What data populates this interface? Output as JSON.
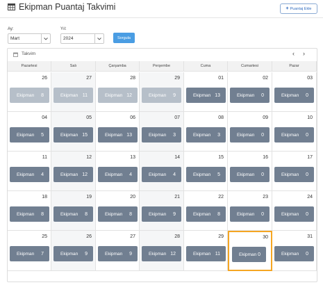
{
  "header": {
    "title": "Ekipman Puantaj Takvimi",
    "add_button": "Puantaj Ekle"
  },
  "filters": {
    "month_label": "Ay:",
    "month_value": "Mart",
    "year_label": "Yıl:",
    "year_value": "2024",
    "query_button": "Sorgula"
  },
  "calendar": {
    "title": "Takvim",
    "prev": "‹",
    "next": "›",
    "days": [
      "Pazartesi",
      "Salı",
      "Çarşamba",
      "Perşembe",
      "Cuma",
      "Cumartesi",
      "Pazar"
    ],
    "badge_label": "Ekipman",
    "weeks": [
      [
        {
          "day": "26",
          "count": "8",
          "faded": true
        },
        {
          "day": "27",
          "count": "11",
          "faded": true
        },
        {
          "day": "28",
          "count": "12",
          "faded": true
        },
        {
          "day": "29",
          "count": "9",
          "faded": true
        },
        {
          "day": "01",
          "count": "13"
        },
        {
          "day": "02",
          "count": "0"
        },
        {
          "day": "03",
          "count": "0"
        }
      ],
      [
        {
          "day": "04",
          "count": "5"
        },
        {
          "day": "05",
          "count": "15"
        },
        {
          "day": "06",
          "count": "13"
        },
        {
          "day": "07",
          "count": "3"
        },
        {
          "day": "08",
          "count": "3"
        },
        {
          "day": "09",
          "count": "0"
        },
        {
          "day": "10",
          "count": "0"
        }
      ],
      [
        {
          "day": "11",
          "count": "4"
        },
        {
          "day": "12",
          "count": "12"
        },
        {
          "day": "13",
          "count": "4"
        },
        {
          "day": "14",
          "count": "4"
        },
        {
          "day": "15",
          "count": "5"
        },
        {
          "day": "16",
          "count": "0"
        },
        {
          "day": "17",
          "count": "0"
        }
      ],
      [
        {
          "day": "18",
          "count": "8"
        },
        {
          "day": "19",
          "count": "8"
        },
        {
          "day": "20",
          "count": "8"
        },
        {
          "day": "21",
          "count": "9"
        },
        {
          "day": "22",
          "count": "8"
        },
        {
          "day": "23",
          "count": "0"
        },
        {
          "day": "24",
          "count": "0"
        }
      ],
      [
        {
          "day": "25",
          "count": "7"
        },
        {
          "day": "26",
          "count": "9"
        },
        {
          "day": "27",
          "count": "9"
        },
        {
          "day": "28",
          "count": "12"
        },
        {
          "day": "29",
          "count": "11"
        },
        {
          "day": "30",
          "count": "0",
          "selected": true
        },
        {
          "day": "31",
          "count": "0"
        }
      ]
    ]
  }
}
